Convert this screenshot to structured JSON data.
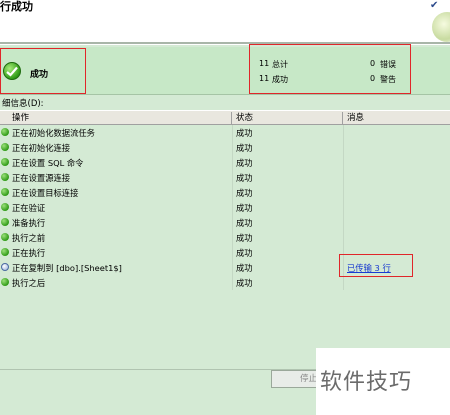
{
  "header": {
    "title": "行成功"
  },
  "summary": {
    "status": "成功",
    "total_count": "11",
    "total_label": "总计",
    "success_count": "11",
    "success_label": "成功",
    "error_count": "0",
    "error_label": "错误",
    "warning_count": "0",
    "warning_label": "警告"
  },
  "details": {
    "label": "细信息(D):",
    "columns": [
      "操作",
      "状态",
      "消息"
    ],
    "rows": [
      {
        "action": "正在初始化数据流任务",
        "status": "成功",
        "message": "",
        "icon": "success-icon"
      },
      {
        "action": "正在初始化连接",
        "status": "成功",
        "message": "",
        "icon": "success-icon"
      },
      {
        "action": "正在设置 SQL 命令",
        "status": "成功",
        "message": "",
        "icon": "success-icon"
      },
      {
        "action": "正在设置源连接",
        "status": "成功",
        "message": "",
        "icon": "success-icon"
      },
      {
        "action": "正在设置目标连接",
        "status": "成功",
        "message": "",
        "icon": "success-icon"
      },
      {
        "action": "正在验证",
        "status": "成功",
        "message": "",
        "icon": "success-icon"
      },
      {
        "action": "准备执行",
        "status": "成功",
        "message": "",
        "icon": "success-icon"
      },
      {
        "action": "执行之前",
        "status": "成功",
        "message": "",
        "icon": "success-icon"
      },
      {
        "action": "正在执行",
        "status": "成功",
        "message": "",
        "icon": "success-icon"
      },
      {
        "action": "正在复制到 [dbo].[Sheet1$]",
        "status": "成功",
        "message": "已传输 3 行",
        "icon": "info-icon"
      },
      {
        "action": "执行之后",
        "status": "成功",
        "message": "",
        "icon": "success-icon"
      }
    ]
  },
  "footer": {
    "stop_label": "停止"
  },
  "watermark": {
    "text": "软件技巧"
  },
  "colors": {
    "highlight": "#e0262a",
    "link": "#1a3bd0",
    "panel": "#c7e8c7"
  }
}
